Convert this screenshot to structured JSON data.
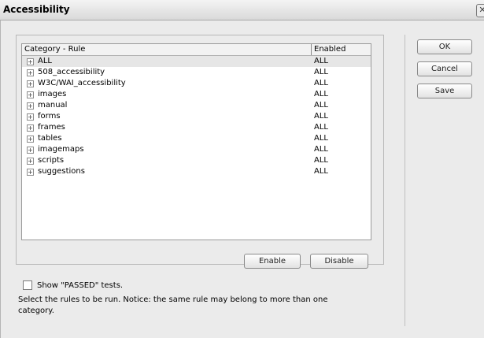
{
  "window": {
    "title": "Accessibility",
    "close_glyph": "✕"
  },
  "table": {
    "headers": {
      "category_rule": "Category - Rule",
      "enabled": "Enabled"
    },
    "rows": [
      {
        "label": "ALL",
        "enabled": "ALL",
        "selected": true
      },
      {
        "label": "508_accessibility",
        "enabled": "ALL"
      },
      {
        "label": "W3C/WAI_accessibility",
        "enabled": "ALL"
      },
      {
        "label": "images",
        "enabled": "ALL"
      },
      {
        "label": "manual",
        "enabled": "ALL"
      },
      {
        "label": "forms",
        "enabled": "ALL"
      },
      {
        "label": "frames",
        "enabled": "ALL"
      },
      {
        "label": "tables",
        "enabled": "ALL"
      },
      {
        "label": "imagemaps",
        "enabled": "ALL"
      },
      {
        "label": "scripts",
        "enabled": "ALL"
      },
      {
        "label": "suggestions",
        "enabled": "ALL"
      }
    ],
    "expander_glyph": "+"
  },
  "buttons": {
    "enable": "Enable",
    "disable": "Disable",
    "ok": "OK",
    "cancel": "Cancel",
    "save": "Save"
  },
  "options": {
    "show_passed_label": "Show \"PASSED\" tests.",
    "show_passed_checked": false
  },
  "note": "Select the rules to be run. Notice: the same rule may belong to more than one category."
}
